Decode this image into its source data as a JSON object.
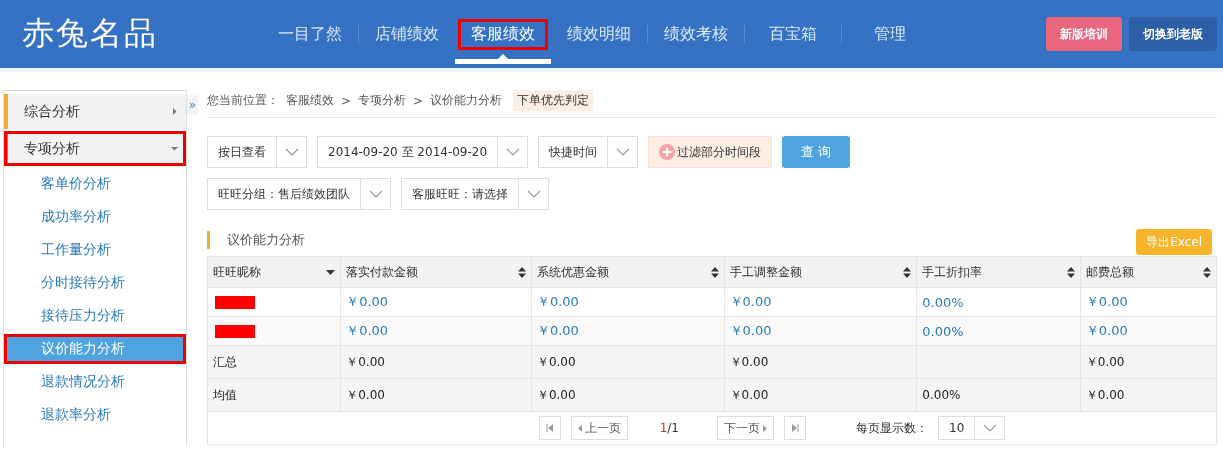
{
  "logo": "赤兔名品",
  "nav": [
    {
      "label": "一目了然",
      "selected": false,
      "highlighted": false
    },
    {
      "label": "店铺绩效",
      "selected": false,
      "highlighted": false
    },
    {
      "label": "客服绩效",
      "selected": true,
      "highlighted": true
    },
    {
      "label": "绩效明细",
      "selected": false,
      "highlighted": false
    },
    {
      "label": "绩效考核",
      "selected": false,
      "highlighted": false
    },
    {
      "label": "百宝箱",
      "selected": false,
      "highlighted": false
    },
    {
      "label": "管理",
      "selected": false,
      "highlighted": false
    }
  ],
  "header_buttons": [
    {
      "label": "新版培训",
      "kind": "training"
    },
    {
      "label": "切换到老版",
      "kind": "switch"
    }
  ],
  "sidebar": {
    "toggle": "»",
    "items": [
      {
        "label": "综合分析",
        "expanded": false,
        "highlighted": false,
        "color": "#f0ad3c"
      },
      {
        "label": "专项分析",
        "expanded": true,
        "highlighted": true,
        "color": "#3cb371",
        "children": [
          {
            "label": "客单价分析",
            "selected": false,
            "highlighted": false
          },
          {
            "label": "成功率分析",
            "selected": false,
            "highlighted": false
          },
          {
            "label": "工作量分析",
            "selected": false,
            "highlighted": false
          },
          {
            "label": "分时接待分析",
            "selected": false,
            "highlighted": false
          },
          {
            "label": "接待压力分析",
            "selected": false,
            "highlighted": false
          },
          {
            "label": "议价能力分析",
            "selected": true,
            "highlighted": true
          },
          {
            "label": "退款情况分析",
            "selected": false,
            "highlighted": false
          },
          {
            "label": "退款率分析",
            "selected": false,
            "highlighted": false
          }
        ]
      }
    ]
  },
  "breadcrumb": {
    "label": "您当前位置：",
    "separator": ">",
    "path": [
      "客服绩效",
      "专项分析",
      "议价能力分析"
    ],
    "tag": "下单优先判定"
  },
  "filters": {
    "row_1": [
      {
        "value": "按日查看"
      },
      {
        "value": "2014-09-20 至 2014-09-20"
      },
      {
        "value": "快捷时间"
      }
    ],
    "filter_button": "过滤部分时间段",
    "query_button": "查 询",
    "row_2": [
      {
        "value": "旺旺分组：售后绩效团队"
      },
      {
        "value": "客服旺旺：请选择"
      }
    ]
  },
  "section_title": "议价能力分析",
  "export_button": "导出Excel",
  "table": {
    "columns": [
      {
        "label": "旺旺昵称",
        "sorted_desc": true
      },
      {
        "label": "落实付款金额",
        "sorted_desc": false
      },
      {
        "label": "系统优惠金额",
        "sorted_desc": false
      },
      {
        "label": "手工调整金额",
        "sorted_desc": false
      },
      {
        "label": "手工折扣率",
        "sorted_desc": false
      },
      {
        "label": "邮费总额",
        "sorted_desc": false
      }
    ],
    "rows": [
      {
        "kind": "data",
        "name_redacted": true,
        "cells": [
          null,
          "￥0.00",
          "￥0.00",
          "￥0.00",
          "0.00%",
          "￥0.00"
        ]
      },
      {
        "kind": "data",
        "name_redacted": true,
        "cells": [
          null,
          "￥0.00",
          "￥0.00",
          "￥0.00",
          "0.00%",
          "￥0.00"
        ]
      },
      {
        "kind": "summary",
        "cells": [
          "汇总",
          "￥0.00",
          "￥0.00",
          "￥0.00",
          null,
          "￥0.00"
        ]
      },
      {
        "kind": "summary",
        "cells": [
          "均值",
          "￥0.00",
          "￥0.00",
          "￥0.00",
          "0.00%",
          "￥0.00"
        ]
      }
    ]
  },
  "pagination": {
    "prev": "上一页",
    "current": "1",
    "total": "/1",
    "next": "下一页",
    "page_size_label": "每页显示数：",
    "page_size": "10"
  }
}
